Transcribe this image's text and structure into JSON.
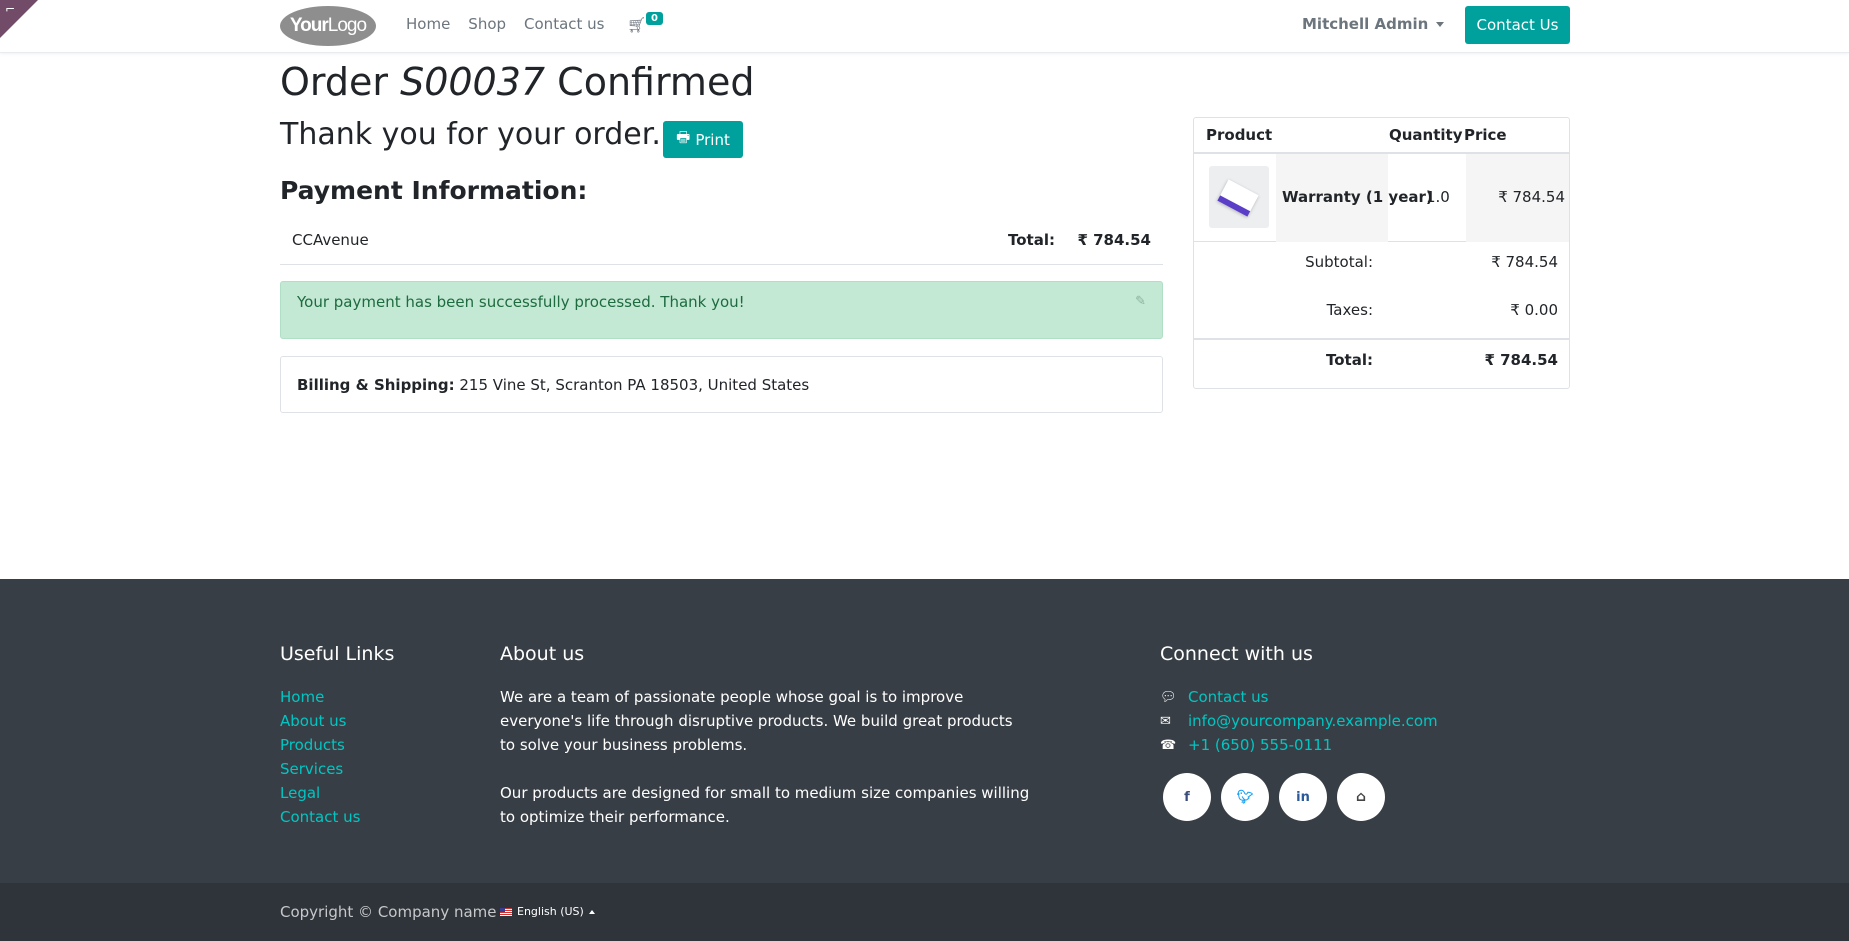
{
  "header": {
    "logo_text_a": "Your",
    "logo_text_b": "Logo",
    "nav": [
      "Home",
      "Shop",
      "Contact us"
    ],
    "cart_count": "0",
    "user": "Mitchell Admin",
    "contact_button": "Contact Us"
  },
  "order": {
    "title_prefix": "Order ",
    "number": "S00037",
    "title_suffix": " Confirmed",
    "thanks": "Thank you for your order.",
    "print_label": "Print",
    "payment_heading": "Payment Information:",
    "payment_method": "CCAvenue",
    "total_label": "Total:",
    "total_value": "₹ 784.54",
    "alert": "Your payment has been successfully processed. Thank you!",
    "billing_label": "Billing & Shipping:",
    "billing_address": " 215 Vine St, Scranton PA 18503, United States"
  },
  "summary": {
    "headers": [
      "Product",
      "Quantity",
      "Price"
    ],
    "line": {
      "name": "Warranty (1 year)",
      "qty": "1.0",
      "price": "₹ 784.54"
    },
    "subtotal_label": "Subtotal:",
    "subtotal_value": "₹ 784.54",
    "taxes_label": "Taxes:",
    "taxes_value": "₹ 0.00",
    "total_label": "Total:",
    "total_value": "₹ 784.54"
  },
  "footer": {
    "useful_title": "Useful Links",
    "useful_links": [
      "Home",
      "About us",
      "Products",
      "Services",
      "Legal",
      "Contact us"
    ],
    "about_title": "About us",
    "about_p1": "We are a team of passionate people whose goal is to improve everyone's life through disruptive products. We build great products to solve your business problems.",
    "about_p2": "Our products are designed for small to medium size companies willing to optimize their performance.",
    "connect_title": "Connect with us",
    "connect": {
      "contact": "Contact us",
      "email": "info@yourcompany.example.com",
      "phone": "+1 (650) 555-0111"
    },
    "socials": [
      "facebook-icon",
      "twitter-icon",
      "linkedin-icon",
      "home-icon"
    ],
    "copyright": "Copyright © Company name",
    "language": "English (US)"
  },
  "colors": {
    "accent": "#00a09d",
    "footer_bg": "#383e45",
    "link": "#00c6c3",
    "alert_bg": "#c3e8d4"
  }
}
